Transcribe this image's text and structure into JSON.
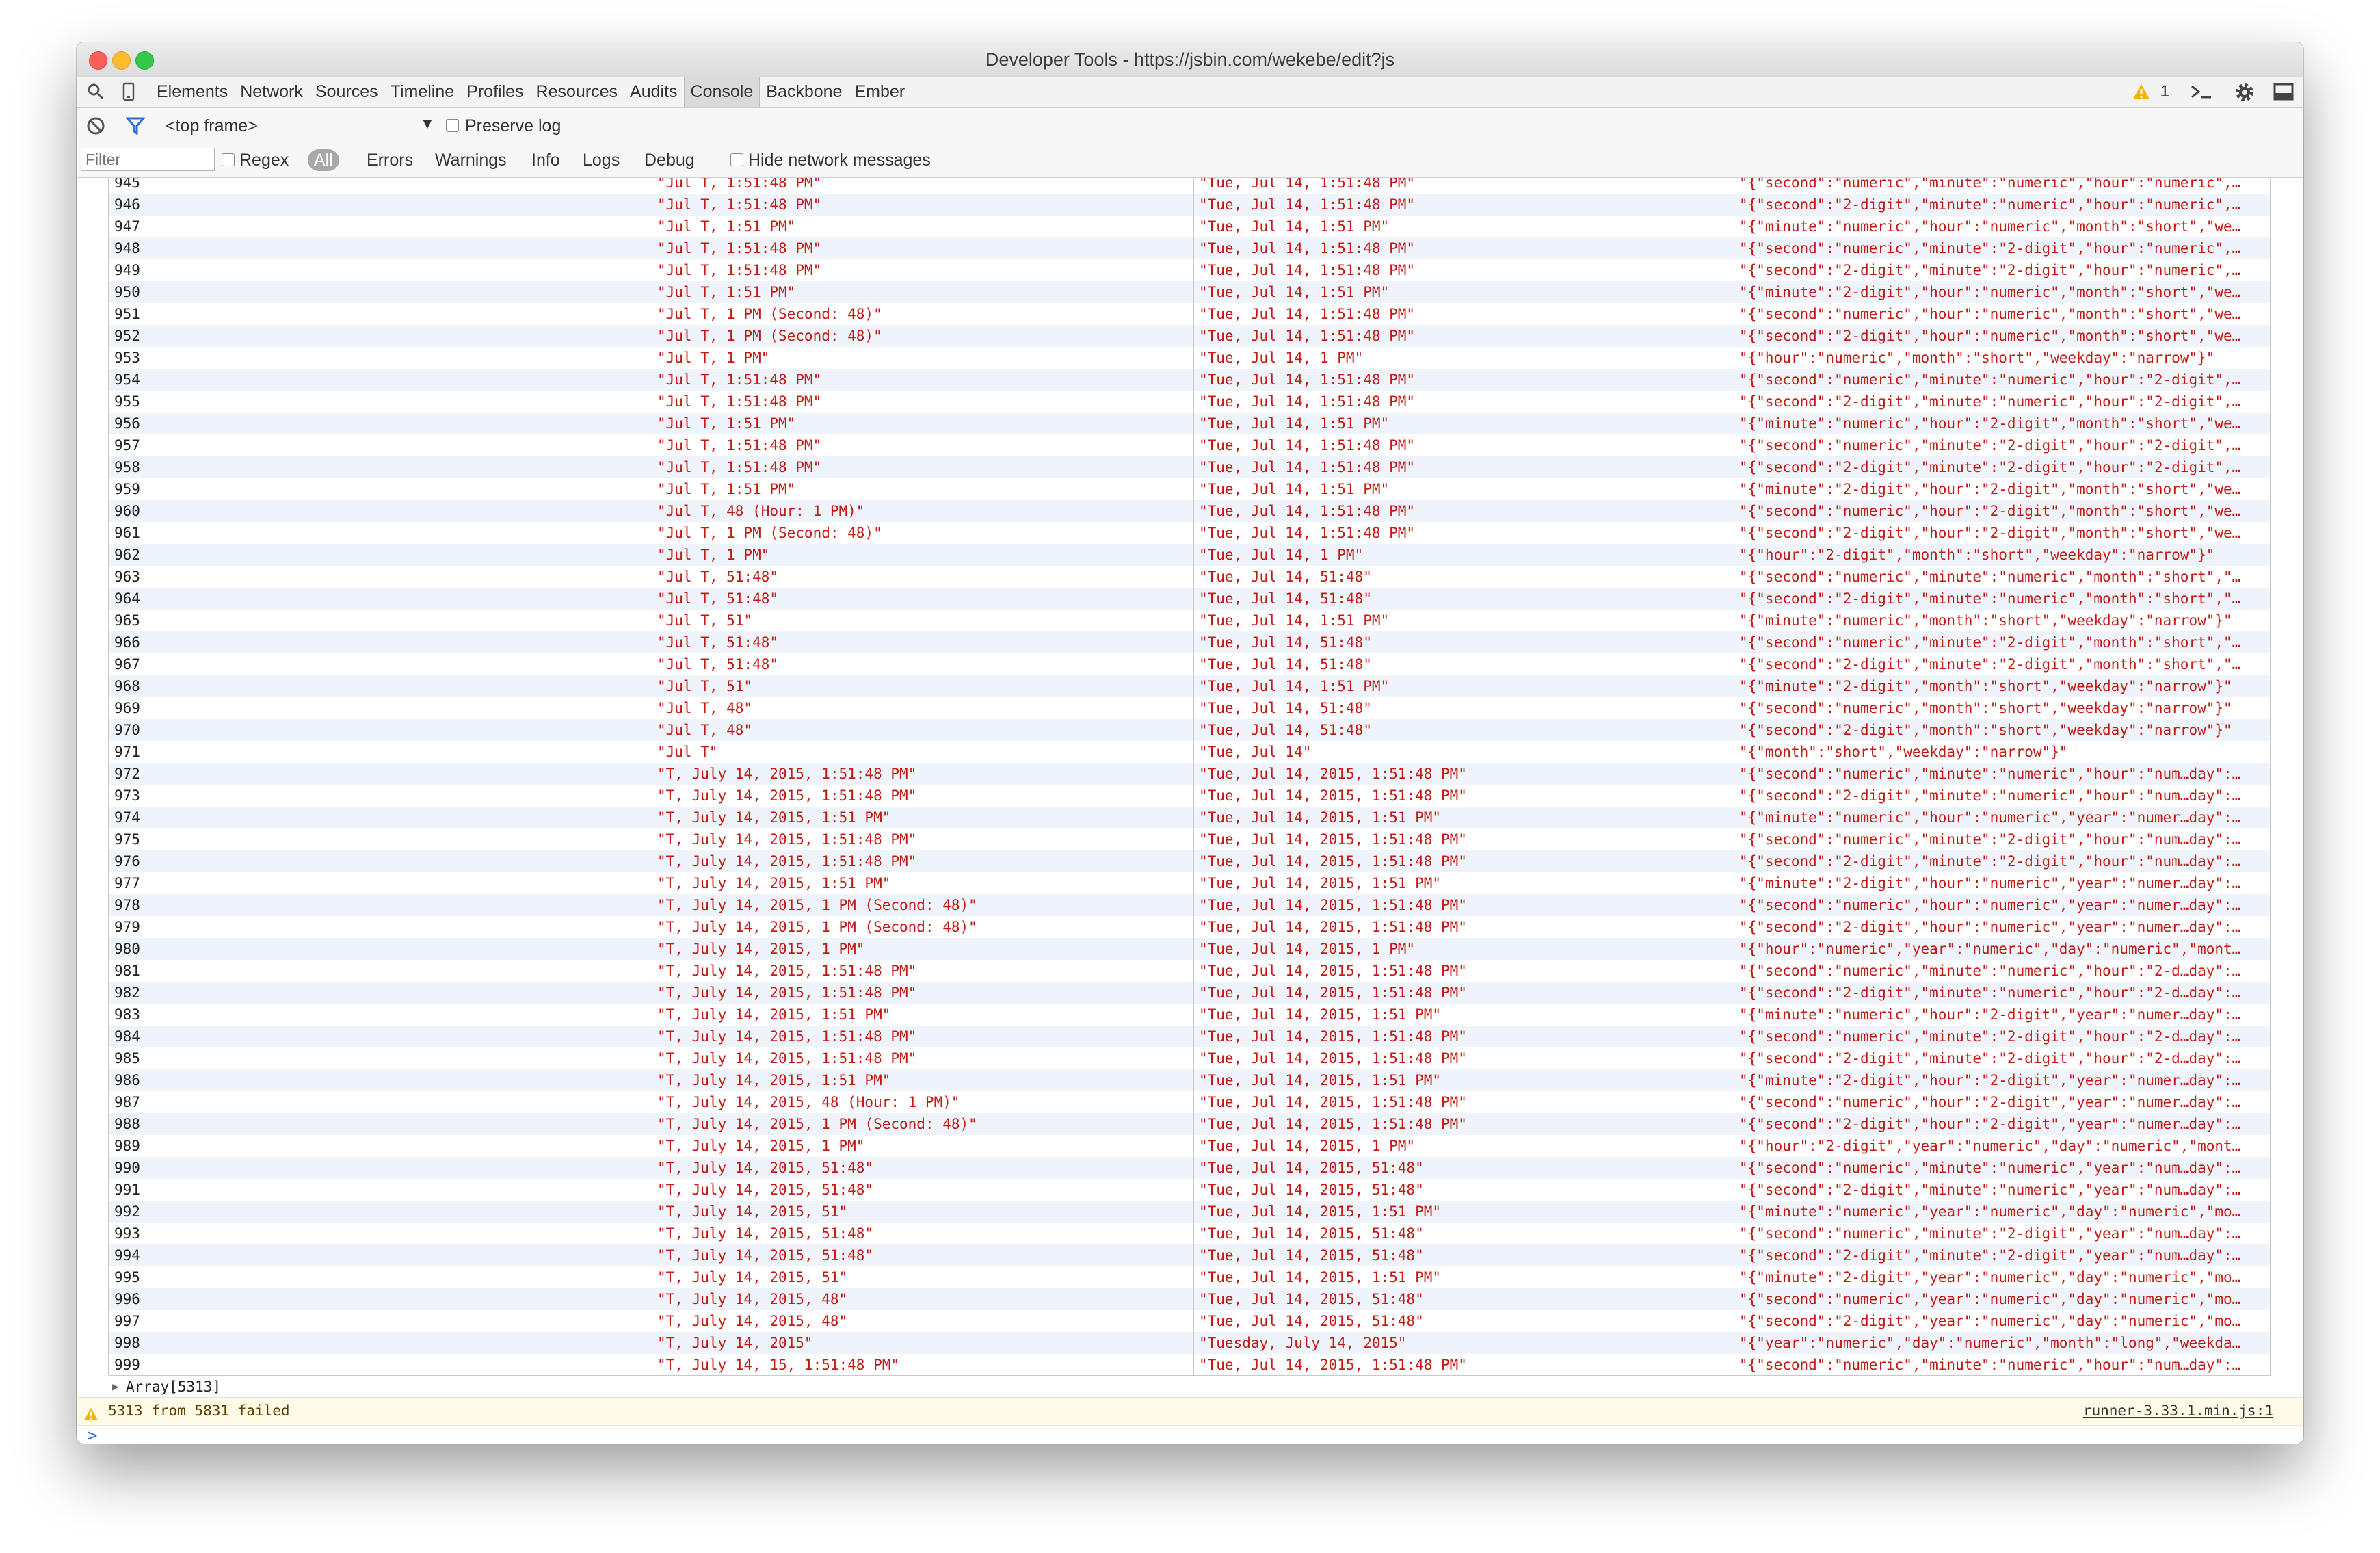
{
  "window": {
    "title": "Developer Tools - https://jsbin.com/wekebe/edit?js"
  },
  "tabs": [
    "Elements",
    "Network",
    "Sources",
    "Timeline",
    "Profiles",
    "Resources",
    "Audits",
    "Console",
    "Backbone",
    "Ember"
  ],
  "active_tab": "Console",
  "warning_count": "1",
  "console_toolbar": {
    "frame": "<top frame>",
    "preserve_log": "Preserve log",
    "filter_placeholder": "Filter",
    "regex": "Regex",
    "levels": [
      "All",
      "Errors",
      "Warnings",
      "Info",
      "Logs",
      "Debug"
    ],
    "hide_network": "Hide network messages"
  },
  "table_rows": [
    [
      "945",
      "\"Jul T, 1:51:48 PM\"",
      "\"Tue, Jul 14, 1:51:48 PM\"",
      "\"{\"second\":\"numeric\",\"minute\":\"numeric\",\"hour\":\"numeric\",…"
    ],
    [
      "946",
      "\"Jul T, 1:51:48 PM\"",
      "\"Tue, Jul 14, 1:51:48 PM\"",
      "\"{\"second\":\"2-digit\",\"minute\":\"numeric\",\"hour\":\"numeric\",…"
    ],
    [
      "947",
      "\"Jul T, 1:51 PM\"",
      "\"Tue, Jul 14, 1:51 PM\"",
      "\"{\"minute\":\"numeric\",\"hour\":\"numeric\",\"month\":\"short\",\"we…"
    ],
    [
      "948",
      "\"Jul T, 1:51:48 PM\"",
      "\"Tue, Jul 14, 1:51:48 PM\"",
      "\"{\"second\":\"numeric\",\"minute\":\"2-digit\",\"hour\":\"numeric\",…"
    ],
    [
      "949",
      "\"Jul T, 1:51:48 PM\"",
      "\"Tue, Jul 14, 1:51:48 PM\"",
      "\"{\"second\":\"2-digit\",\"minute\":\"2-digit\",\"hour\":\"numeric\",…"
    ],
    [
      "950",
      "\"Jul T, 1:51 PM\"",
      "\"Tue, Jul 14, 1:51 PM\"",
      "\"{\"minute\":\"2-digit\",\"hour\":\"numeric\",\"month\":\"short\",\"we…"
    ],
    [
      "951",
      "\"Jul T, 1 PM (Second: 48)\"",
      "\"Tue, Jul 14, 1:51:48 PM\"",
      "\"{\"second\":\"numeric\",\"hour\":\"numeric\",\"month\":\"short\",\"we…"
    ],
    [
      "952",
      "\"Jul T, 1 PM (Second: 48)\"",
      "\"Tue, Jul 14, 1:51:48 PM\"",
      "\"{\"second\":\"2-digit\",\"hour\":\"numeric\",\"month\":\"short\",\"we…"
    ],
    [
      "953",
      "\"Jul T, 1 PM\"",
      "\"Tue, Jul 14, 1 PM\"",
      "\"{\"hour\":\"numeric\",\"month\":\"short\",\"weekday\":\"narrow\"}\""
    ],
    [
      "954",
      "\"Jul T, 1:51:48 PM\"",
      "\"Tue, Jul 14, 1:51:48 PM\"",
      "\"{\"second\":\"numeric\",\"minute\":\"numeric\",\"hour\":\"2-digit\",…"
    ],
    [
      "955",
      "\"Jul T, 1:51:48 PM\"",
      "\"Tue, Jul 14, 1:51:48 PM\"",
      "\"{\"second\":\"2-digit\",\"minute\":\"numeric\",\"hour\":\"2-digit\",…"
    ],
    [
      "956",
      "\"Jul T, 1:51 PM\"",
      "\"Tue, Jul 14, 1:51 PM\"",
      "\"{\"minute\":\"numeric\",\"hour\":\"2-digit\",\"month\":\"short\",\"we…"
    ],
    [
      "957",
      "\"Jul T, 1:51:48 PM\"",
      "\"Tue, Jul 14, 1:51:48 PM\"",
      "\"{\"second\":\"numeric\",\"minute\":\"2-digit\",\"hour\":\"2-digit\",…"
    ],
    [
      "958",
      "\"Jul T, 1:51:48 PM\"",
      "\"Tue, Jul 14, 1:51:48 PM\"",
      "\"{\"second\":\"2-digit\",\"minute\":\"2-digit\",\"hour\":\"2-digit\",…"
    ],
    [
      "959",
      "\"Jul T, 1:51 PM\"",
      "\"Tue, Jul 14, 1:51 PM\"",
      "\"{\"minute\":\"2-digit\",\"hour\":\"2-digit\",\"month\":\"short\",\"we…"
    ],
    [
      "960",
      "\"Jul T, 48 (Hour: 1 PM)\"",
      "\"Tue, Jul 14, 1:51:48 PM\"",
      "\"{\"second\":\"numeric\",\"hour\":\"2-digit\",\"month\":\"short\",\"we…"
    ],
    [
      "961",
      "\"Jul T, 1 PM (Second: 48)\"",
      "\"Tue, Jul 14, 1:51:48 PM\"",
      "\"{\"second\":\"2-digit\",\"hour\":\"2-digit\",\"month\":\"short\",\"we…"
    ],
    [
      "962",
      "\"Jul T, 1 PM\"",
      "\"Tue, Jul 14, 1 PM\"",
      "\"{\"hour\":\"2-digit\",\"month\":\"short\",\"weekday\":\"narrow\"}\""
    ],
    [
      "963",
      "\"Jul T, 51:48\"",
      "\"Tue, Jul 14, 51:48\"",
      "\"{\"second\":\"numeric\",\"minute\":\"numeric\",\"month\":\"short\",\"…"
    ],
    [
      "964",
      "\"Jul T, 51:48\"",
      "\"Tue, Jul 14, 51:48\"",
      "\"{\"second\":\"2-digit\",\"minute\":\"numeric\",\"month\":\"short\",\"…"
    ],
    [
      "965",
      "\"Jul T, 51\"",
      "\"Tue, Jul 14, 1:51 PM\"",
      "\"{\"minute\":\"numeric\",\"month\":\"short\",\"weekday\":\"narrow\"}\""
    ],
    [
      "966",
      "\"Jul T, 51:48\"",
      "\"Tue, Jul 14, 51:48\"",
      "\"{\"second\":\"numeric\",\"minute\":\"2-digit\",\"month\":\"short\",\"…"
    ],
    [
      "967",
      "\"Jul T, 51:48\"",
      "\"Tue, Jul 14, 51:48\"",
      "\"{\"second\":\"2-digit\",\"minute\":\"2-digit\",\"month\":\"short\",\"…"
    ],
    [
      "968",
      "\"Jul T, 51\"",
      "\"Tue, Jul 14, 1:51 PM\"",
      "\"{\"minute\":\"2-digit\",\"month\":\"short\",\"weekday\":\"narrow\"}\""
    ],
    [
      "969",
      "\"Jul T, 48\"",
      "\"Tue, Jul 14, 51:48\"",
      "\"{\"second\":\"numeric\",\"month\":\"short\",\"weekday\":\"narrow\"}\""
    ],
    [
      "970",
      "\"Jul T, 48\"",
      "\"Tue, Jul 14, 51:48\"",
      "\"{\"second\":\"2-digit\",\"month\":\"short\",\"weekday\":\"narrow\"}\""
    ],
    [
      "971",
      "\"Jul T\"",
      "\"Tue, Jul 14\"",
      "\"{\"month\":\"short\",\"weekday\":\"narrow\"}\""
    ],
    [
      "972",
      "\"T, July 14, 2015, 1:51:48 PM\"",
      "\"Tue, Jul 14, 2015, 1:51:48 PM\"",
      "\"{\"second\":\"numeric\",\"minute\":\"numeric\",\"hour\":\"num…day\":…"
    ],
    [
      "973",
      "\"T, July 14, 2015, 1:51:48 PM\"",
      "\"Tue, Jul 14, 2015, 1:51:48 PM\"",
      "\"{\"second\":\"2-digit\",\"minute\":\"numeric\",\"hour\":\"num…day\":…"
    ],
    [
      "974",
      "\"T, July 14, 2015, 1:51 PM\"",
      "\"Tue, Jul 14, 2015, 1:51 PM\"",
      "\"{\"minute\":\"numeric\",\"hour\":\"numeric\",\"year\":\"numer…day\":…"
    ],
    [
      "975",
      "\"T, July 14, 2015, 1:51:48 PM\"",
      "\"Tue, Jul 14, 2015, 1:51:48 PM\"",
      "\"{\"second\":\"numeric\",\"minute\":\"2-digit\",\"hour\":\"num…day\":…"
    ],
    [
      "976",
      "\"T, July 14, 2015, 1:51:48 PM\"",
      "\"Tue, Jul 14, 2015, 1:51:48 PM\"",
      "\"{\"second\":\"2-digit\",\"minute\":\"2-digit\",\"hour\":\"num…day\":…"
    ],
    [
      "977",
      "\"T, July 14, 2015, 1:51 PM\"",
      "\"Tue, Jul 14, 2015, 1:51 PM\"",
      "\"{\"minute\":\"2-digit\",\"hour\":\"numeric\",\"year\":\"numer…day\":…"
    ],
    [
      "978",
      "\"T, July 14, 2015, 1 PM (Second: 48)\"",
      "\"Tue, Jul 14, 2015, 1:51:48 PM\"",
      "\"{\"second\":\"numeric\",\"hour\":\"numeric\",\"year\":\"numer…day\":…"
    ],
    [
      "979",
      "\"T, July 14, 2015, 1 PM (Second: 48)\"",
      "\"Tue, Jul 14, 2015, 1:51:48 PM\"",
      "\"{\"second\":\"2-digit\",\"hour\":\"numeric\",\"year\":\"numer…day\":…"
    ],
    [
      "980",
      "\"T, July 14, 2015, 1 PM\"",
      "\"Tue, Jul 14, 2015, 1 PM\"",
      "\"{\"hour\":\"numeric\",\"year\":\"numeric\",\"day\":\"numeric\",\"mont…"
    ],
    [
      "981",
      "\"T, July 14, 2015, 1:51:48 PM\"",
      "\"Tue, Jul 14, 2015, 1:51:48 PM\"",
      "\"{\"second\":\"numeric\",\"minute\":\"numeric\",\"hour\":\"2-d…day\":…"
    ],
    [
      "982",
      "\"T, July 14, 2015, 1:51:48 PM\"",
      "\"Tue, Jul 14, 2015, 1:51:48 PM\"",
      "\"{\"second\":\"2-digit\",\"minute\":\"numeric\",\"hour\":\"2-d…day\":…"
    ],
    [
      "983",
      "\"T, July 14, 2015, 1:51 PM\"",
      "\"Tue, Jul 14, 2015, 1:51 PM\"",
      "\"{\"minute\":\"numeric\",\"hour\":\"2-digit\",\"year\":\"numer…day\":…"
    ],
    [
      "984",
      "\"T, July 14, 2015, 1:51:48 PM\"",
      "\"Tue, Jul 14, 2015, 1:51:48 PM\"",
      "\"{\"second\":\"numeric\",\"minute\":\"2-digit\",\"hour\":\"2-d…day\":…"
    ],
    [
      "985",
      "\"T, July 14, 2015, 1:51:48 PM\"",
      "\"Tue, Jul 14, 2015, 1:51:48 PM\"",
      "\"{\"second\":\"2-digit\",\"minute\":\"2-digit\",\"hour\":\"2-d…day\":…"
    ],
    [
      "986",
      "\"T, July 14, 2015, 1:51 PM\"",
      "\"Tue, Jul 14, 2015, 1:51 PM\"",
      "\"{\"minute\":\"2-digit\",\"hour\":\"2-digit\",\"year\":\"numer…day\":…"
    ],
    [
      "987",
      "\"T, July 14, 2015, 48 (Hour: 1 PM)\"",
      "\"Tue, Jul 14, 2015, 1:51:48 PM\"",
      "\"{\"second\":\"numeric\",\"hour\":\"2-digit\",\"year\":\"numer…day\":…"
    ],
    [
      "988",
      "\"T, July 14, 2015, 1 PM (Second: 48)\"",
      "\"Tue, Jul 14, 2015, 1:51:48 PM\"",
      "\"{\"second\":\"2-digit\",\"hour\":\"2-digit\",\"year\":\"numer…day\":…"
    ],
    [
      "989",
      "\"T, July 14, 2015, 1 PM\"",
      "\"Tue, Jul 14, 2015, 1 PM\"",
      "\"{\"hour\":\"2-digit\",\"year\":\"numeric\",\"day\":\"numeric\",\"mont…"
    ],
    [
      "990",
      "\"T, July 14, 2015, 51:48\"",
      "\"Tue, Jul 14, 2015, 51:48\"",
      "\"{\"second\":\"numeric\",\"minute\":\"numeric\",\"year\":\"num…day\":…"
    ],
    [
      "991",
      "\"T, July 14, 2015, 51:48\"",
      "\"Tue, Jul 14, 2015, 51:48\"",
      "\"{\"second\":\"2-digit\",\"minute\":\"numeric\",\"year\":\"num…day\":…"
    ],
    [
      "992",
      "\"T, July 14, 2015, 51\"",
      "\"Tue, Jul 14, 2015, 1:51 PM\"",
      "\"{\"minute\":\"numeric\",\"year\":\"numeric\",\"day\":\"numeric\",\"mo…"
    ],
    [
      "993",
      "\"T, July 14, 2015, 51:48\"",
      "\"Tue, Jul 14, 2015, 51:48\"",
      "\"{\"second\":\"numeric\",\"minute\":\"2-digit\",\"year\":\"num…day\":…"
    ],
    [
      "994",
      "\"T, July 14, 2015, 51:48\"",
      "\"Tue, Jul 14, 2015, 51:48\"",
      "\"{\"second\":\"2-digit\",\"minute\":\"2-digit\",\"year\":\"num…day\":…"
    ],
    [
      "995",
      "\"T, July 14, 2015, 51\"",
      "\"Tue, Jul 14, 2015, 1:51 PM\"",
      "\"{\"minute\":\"2-digit\",\"year\":\"numeric\",\"day\":\"numeric\",\"mo…"
    ],
    [
      "996",
      "\"T, July 14, 2015, 48\"",
      "\"Tue, Jul 14, 2015, 51:48\"",
      "\"{\"second\":\"numeric\",\"year\":\"numeric\",\"day\":\"numeric\",\"mo…"
    ],
    [
      "997",
      "\"T, July 14, 2015, 48\"",
      "\"Tue, Jul 14, 2015, 51:48\"",
      "\"{\"second\":\"2-digit\",\"year\":\"numeric\",\"day\":\"numeric\",\"mo…"
    ],
    [
      "998",
      "\"T, July 14, 2015\"",
      "\"Tuesday, July 14, 2015\"",
      "\"{\"year\":\"numeric\",\"day\":\"numeric\",\"month\":\"long\",\"weekda…"
    ],
    [
      "999",
      "\"T, July 14, 15, 1:51:48 PM\"",
      "\"Tue, Jul 14, 2015, 1:51:48 PM\"",
      "\"{\"second\":\"numeric\",\"minute\":\"numeric\",\"hour\":\"num…day\":…"
    ]
  ],
  "array_summary": "Array[5313]",
  "warning_message": "5313 from 5831 failed",
  "warning_source": "runner-3.33.1.min.js:1",
  "prompt_symbol": ">",
  "icons": [
    "search-icon",
    "device-icon",
    "clear-icon",
    "filter-icon",
    "dropdown-arrow-icon",
    "warning-icon",
    "drawer-icon",
    "settings-icon",
    "dock-icon",
    "expand-arrow-icon",
    "prompt-icon"
  ],
  "colors": {
    "string_red": "#c41a16",
    "row_alt": "#eff4fb",
    "warning_bg": "#fffbe6",
    "prompt_blue": "#2b6cd6"
  }
}
